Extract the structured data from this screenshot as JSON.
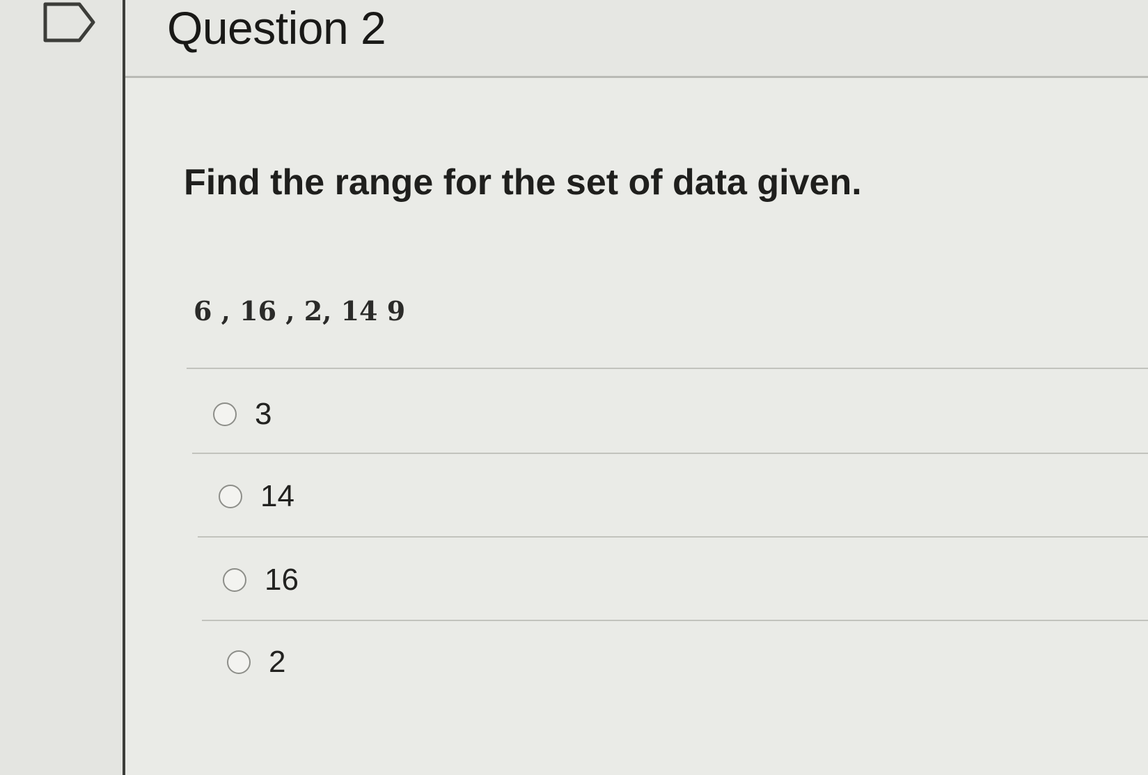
{
  "question": {
    "title": "Question 2",
    "prompt": "Find the range for the set of data given.",
    "data_set": "6 , 16 , 2,  14  9"
  },
  "options": [
    {
      "label": "3",
      "selected": false
    },
    {
      "label": "14",
      "selected": false
    },
    {
      "label": "16",
      "selected": false
    },
    {
      "label": "2",
      "selected": false
    }
  ],
  "icons": {
    "flag": "flag-icon"
  }
}
